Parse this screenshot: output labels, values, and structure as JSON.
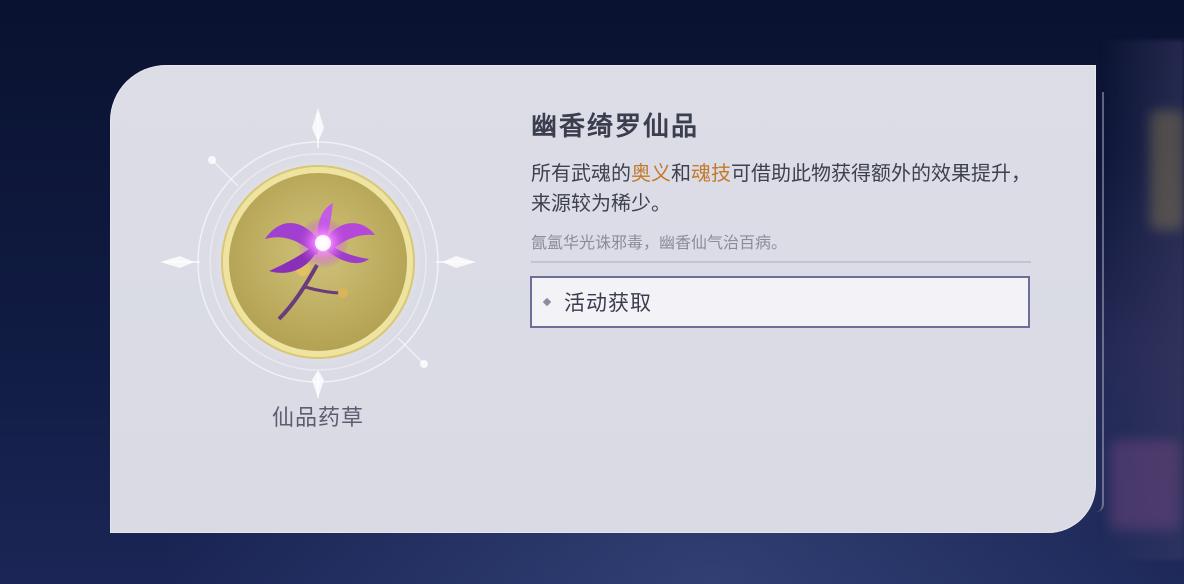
{
  "item": {
    "icon": "purple-flower-icon",
    "name": "仙品药草",
    "frame_color": "#d8c777"
  },
  "detail": {
    "title": "幽香绮罗仙品",
    "description": {
      "part1": "所有武魂的",
      "highlight1": "奥义",
      "part2": "和",
      "highlight2": "魂技",
      "part3": "可借助此物获得额外的效果提升，来源较为稀少。"
    },
    "flavor": "氤氲华光诛邪毒，幽香仙气治百病。",
    "highlight_color": "#c27a2c"
  },
  "source": {
    "label": "活动获取",
    "icon": "diamond-bullet-icon"
  }
}
